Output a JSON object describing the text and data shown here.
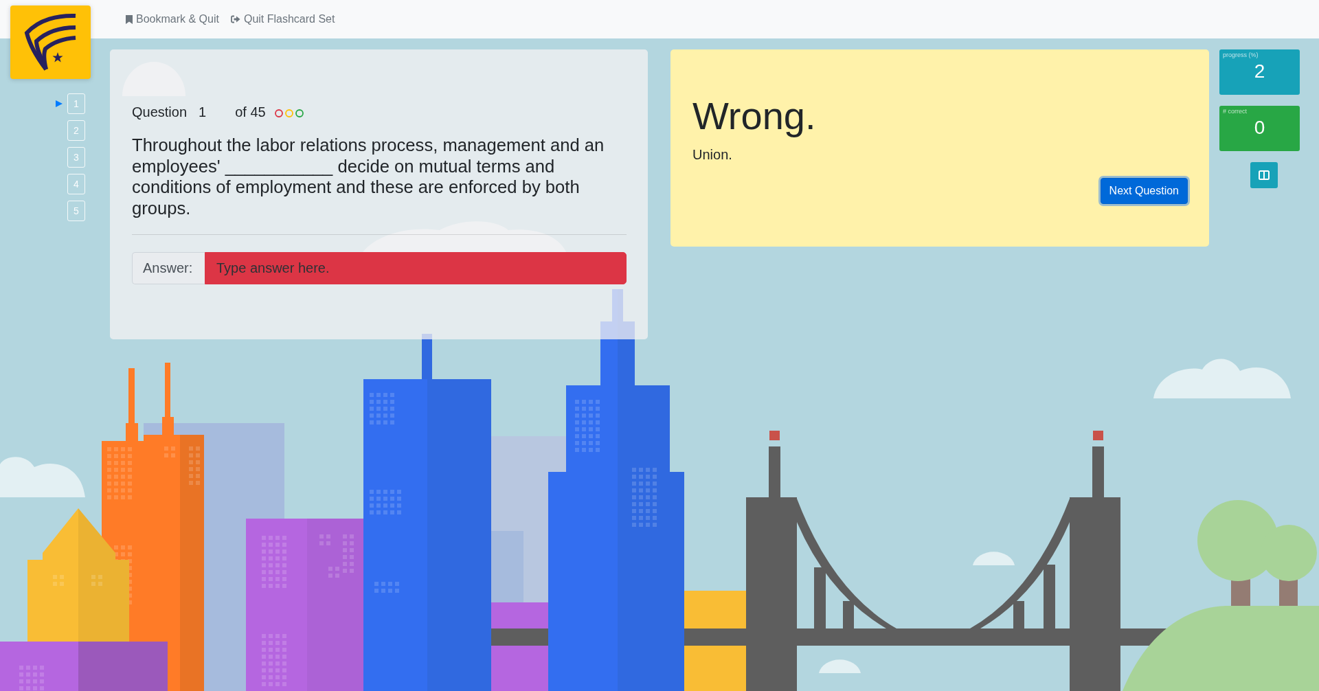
{
  "nav": {
    "links": [
      {
        "label": "Bookmark & Quit",
        "kind": "bookmark"
      },
      {
        "label": "Quit Flashcard Set",
        "kind": "quit"
      }
    ]
  },
  "question_nav": [
    {
      "label": "1",
      "selected": true
    },
    {
      "label": "2",
      "selected": false
    },
    {
      "label": "3",
      "selected": false
    },
    {
      "label": "4",
      "selected": false
    },
    {
      "label": "5",
      "selected": false
    }
  ],
  "question": {
    "label": "Question",
    "number": "1",
    "total": "of 45",
    "status_circles": [
      {
        "color": "#dc3545"
      },
      {
        "color": "#ffc107"
      },
      {
        "color": "#28a745"
      }
    ],
    "text": "Throughout the labor relations process, management and an employees' ___________ decide on mutual terms and conditions of employment and these are enforced by both groups.",
    "answer": {
      "label": "Answer:",
      "placeholder": "Type answer here.",
      "incorrect": true
    }
  },
  "feedback": {
    "verdict": "Wrong.",
    "correct_answer": "Union.",
    "button": "Next Question"
  },
  "stats": [
    {
      "label": "progress (%)",
      "value": "2",
      "color": "#17a2b8"
    },
    {
      "label": "# correct",
      "value": "0",
      "color": "#28a745"
    }
  ]
}
